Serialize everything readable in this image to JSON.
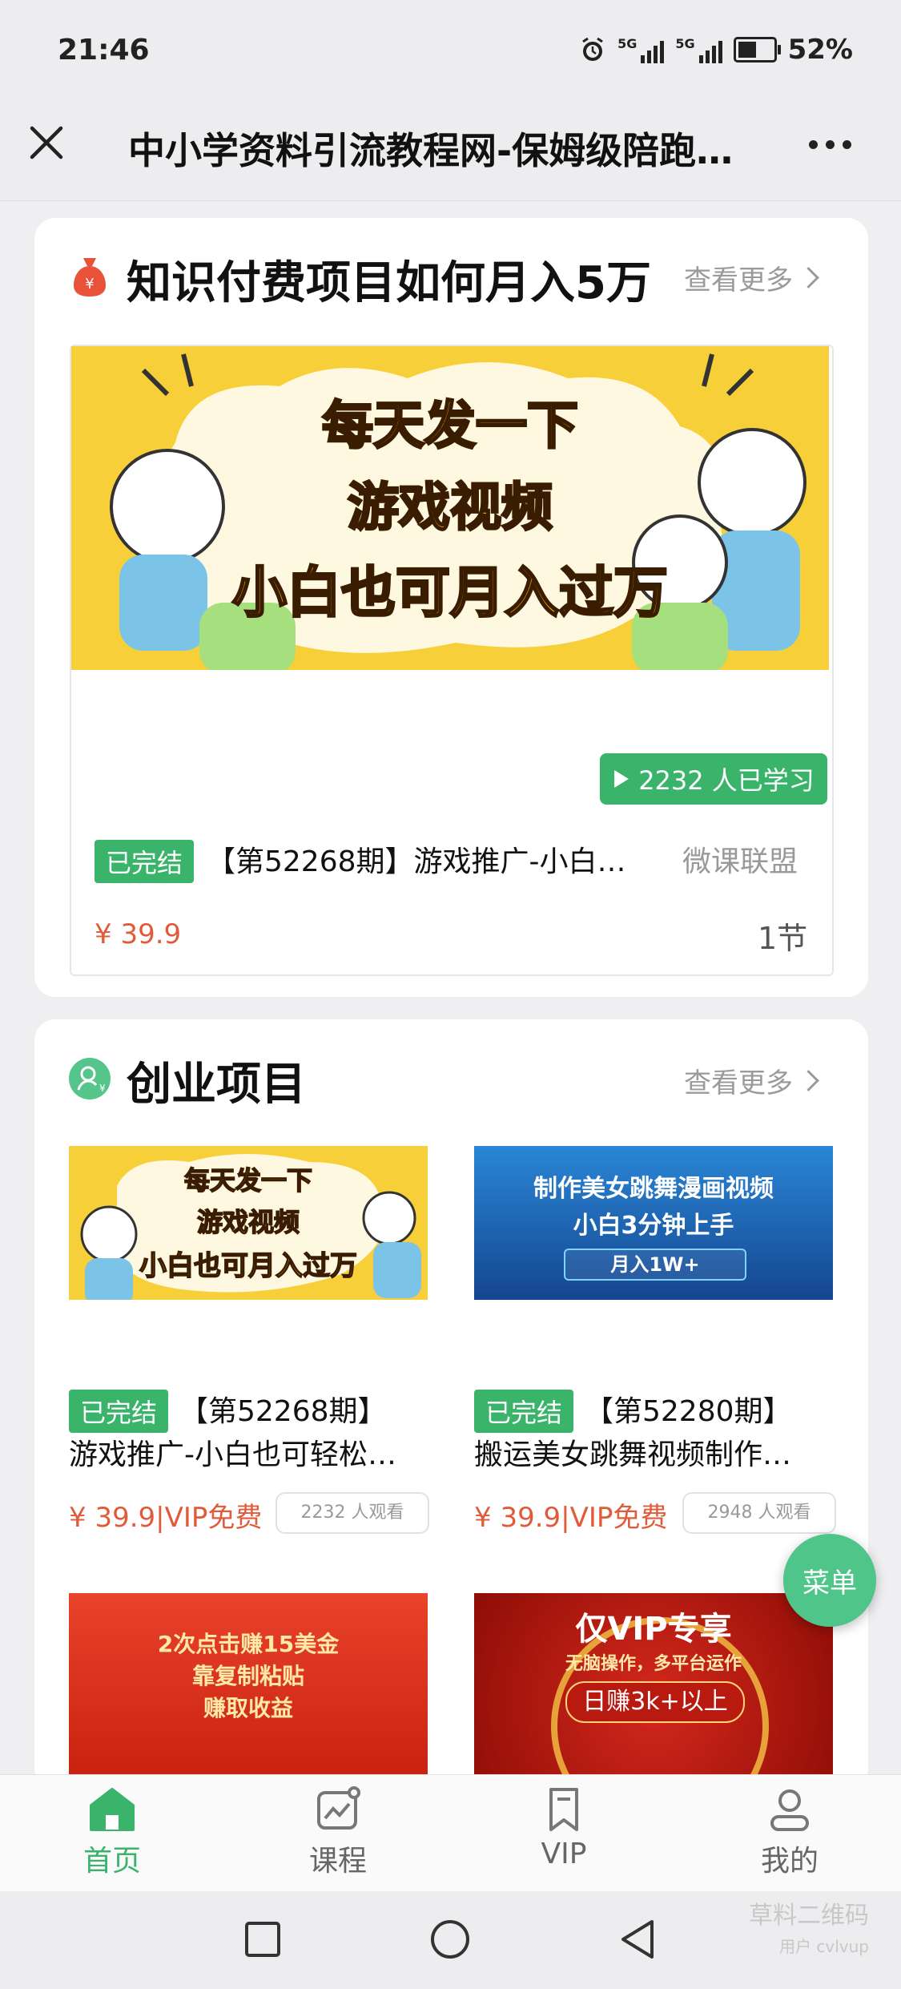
{
  "status_bar": {
    "time": "21:46",
    "network_1": "5G",
    "network_2": "5G",
    "battery": "52%"
  },
  "header": {
    "title": "中小学资料引流教程网-保姆级陪跑…"
  },
  "section1": {
    "title": "知识付费项目如何月入5万",
    "see_more": "查看更多",
    "course": {
      "banner_line1": "每天发一下",
      "banner_line2": "游戏视频",
      "banner_line3": "小白也可月入过万",
      "learners": "2232 人已学习",
      "status": "已完结",
      "title": "【第52268期】游戏推广-小白…",
      "author": "微课联盟",
      "price": "¥ 39.9",
      "lessons": "1节"
    }
  },
  "section2": {
    "title": "创业项目",
    "see_more": "查看更多",
    "items": [
      {
        "banner_line1": "每天发一下",
        "banner_line2": "游戏视频",
        "banner_line3": "小白也可月入过万",
        "status": "已完结",
        "period": "【第52268期】",
        "title": "游戏推广-小白也可轻松…",
        "price": "¥ 39.9|VIP免费",
        "views": "2232 人观看"
      },
      {
        "banner_line1": "制作美女跳舞漫画视频",
        "banner_line2": "小白3分钟上手",
        "banner_line3": "月入1W+",
        "status": "已完结",
        "period": "【第52280期】",
        "title": "搬运美女跳舞视频制作…",
        "price": "¥ 39.9|VIP免费",
        "views": "2948 人观看"
      },
      {
        "banner_line1": "2次点击赚15美金",
        "banner_line2": "靠复制粘贴",
        "banner_line3": "赚取收益"
      },
      {
        "banner_line1": "仅VIP专享",
        "banner_line2": "无脑操作，多平台运作",
        "banner_line3": "日赚3k+以上"
      }
    ]
  },
  "float_menu": {
    "label": "菜单"
  },
  "bottom_nav": [
    {
      "label": "首页",
      "icon": "home-icon",
      "active": true
    },
    {
      "label": "课程",
      "icon": "course-icon",
      "active": false
    },
    {
      "label": "VIP",
      "icon": "bookmark-icon",
      "active": false
    },
    {
      "label": "我的",
      "icon": "user-icon",
      "active": false
    }
  ],
  "watermark": {
    "line1": "草料二维码",
    "line2": "用户 cvlvup"
  },
  "colors": {
    "accent": "#3bb46b",
    "price": "#e15b3a",
    "banner_yellow": "#f6cc2e",
    "banner_blue": "#1f5fae",
    "banner_red": "#e23a22"
  }
}
